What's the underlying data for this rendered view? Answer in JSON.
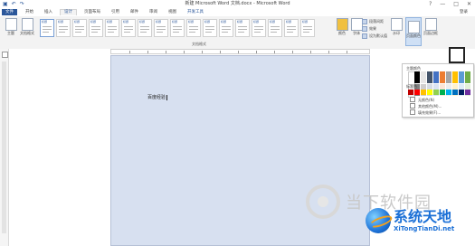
{
  "titlebar": {
    "title": "新建 Microsoft Word 文档.docx - Microsoft Word",
    "qat_icons": [
      "save-icon",
      "undo-icon",
      "redo-icon"
    ],
    "window_controls": {
      "help": "?",
      "minimize": "—",
      "restore": "□",
      "close": "✕"
    }
  },
  "tabs": {
    "file": "文件",
    "items": [
      "开始",
      "插入",
      "设计",
      "页面布局",
      "引用",
      "邮件",
      "审阅",
      "视图",
      "开发工具"
    ],
    "active": "设计",
    "login": "登录"
  },
  "ribbon": {
    "left_buttons": [
      "主题",
      "文档格式"
    ],
    "style_titles": [
      "标题",
      "标题",
      "标题",
      "标题",
      "标题",
      "标题",
      "标题",
      "标题",
      "标题",
      "标题",
      "标题",
      "标题",
      "标题",
      "标题",
      "标题",
      "标题",
      "标题"
    ],
    "group_label": "文档格式",
    "colors_button": "颜色",
    "fonts_button": "字体",
    "paragraph_spacing": "段落间距",
    "effects": "效果",
    "set_default": "设为默认值",
    "watermark_button": "水印",
    "page_color_button": "页面颜色",
    "page_borders_button": "页面边框"
  },
  "document": {
    "text": "百度经验"
  },
  "color_panel": {
    "theme_colors_label": "主题颜色",
    "standard_colors_label": "标准色",
    "theme_colors": [
      "#ffffff",
      "#000000",
      "#e7e6e6",
      "#44546a",
      "#4472c4",
      "#ed7d31",
      "#a5a5a5",
      "#ffc000",
      "#5b9bd5",
      "#70ad47",
      "#f2f2f2",
      "#7f7f7f",
      "#d0cece",
      "#d6dce5",
      "#dae3f3",
      "#fbe5d6",
      "#ededed",
      "#fff2cc",
      "#deebf7",
      "#e2f0d9"
    ],
    "standard_colors": [
      "#c00000",
      "#ff0000",
      "#ffc000",
      "#ffff00",
      "#92d050",
      "#00b050",
      "#00b0f0",
      "#0070c0",
      "#002060",
      "#7030a0"
    ],
    "menu": [
      "无颜色(N)",
      "其他颜色(M)...",
      "填充效果(F)..."
    ]
  },
  "watermarks": {
    "brand1": "当下软件园",
    "brand2_main": "系统天地",
    "brand2_sub": "XiTongTianDi.net"
  }
}
